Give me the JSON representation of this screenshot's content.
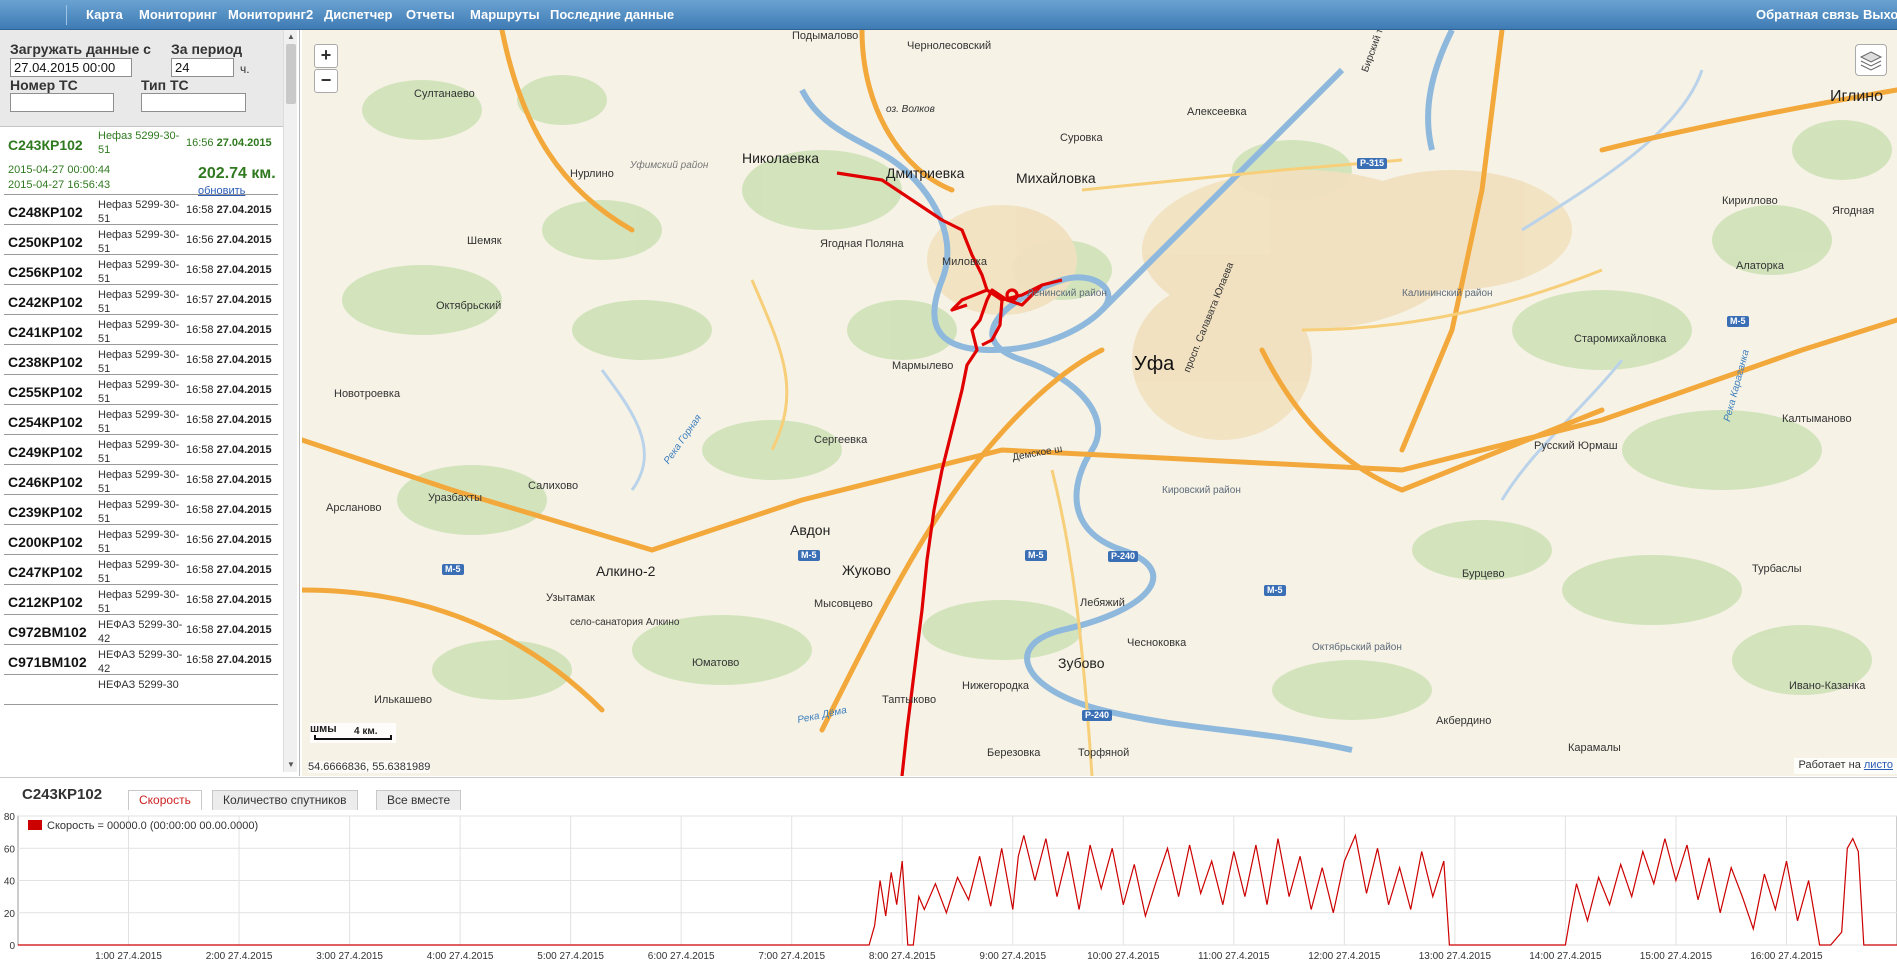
{
  "nav": {
    "left_items": [
      "Карта",
      "Мониторинг",
      "Мониторинг2",
      "Диспетчер",
      "Отчеты",
      "Маршруты",
      "Последние данные"
    ],
    "right_items": [
      "Обратная связь",
      "Выхо"
    ]
  },
  "filters": {
    "load_from_label": "Загружать данные с",
    "load_from_value": "27.04.2015 00:00",
    "period_label": "За период",
    "period_value": "24",
    "period_unit": "ч.",
    "plate_label": "Номер ТС",
    "plate_value": "",
    "type_label": "Тип ТС",
    "type_value": ""
  },
  "vehicles": [
    {
      "plate": "С243КР102",
      "model": "Нефаз 5299-30-51",
      "time": "16:56",
      "date": "27.04.2015",
      "selected": true,
      "range_from": "2015-04-27 00:00:44",
      "range_to": "2015-04-27 16:56:43",
      "distance": "202.74 км.",
      "update_label": "обновить"
    },
    {
      "plate": "С248КР102",
      "model": "Нефаз 5299-30-51",
      "time": "16:58",
      "date": "27.04.2015"
    },
    {
      "plate": "С250КР102",
      "model": "Нефаз 5299-30-51",
      "time": "16:56",
      "date": "27.04.2015"
    },
    {
      "plate": "С256КР102",
      "model": "Нефаз 5299-30-51",
      "time": "16:58",
      "date": "27.04.2015"
    },
    {
      "plate": "С242КР102",
      "model": "Нефаз 5299-30-51",
      "time": "16:57",
      "date": "27.04.2015"
    },
    {
      "plate": "С241КР102",
      "model": "Нефаз 5299-30-51",
      "time": "16:58",
      "date": "27.04.2015"
    },
    {
      "plate": "С238КР102",
      "model": "Нефаз 5299-30-51",
      "time": "16:58",
      "date": "27.04.2015"
    },
    {
      "plate": "С255КР102",
      "model": "Нефаз 5299-30-51",
      "time": "16:58",
      "date": "27.04.2015"
    },
    {
      "plate": "С254КР102",
      "model": "Нефаз 5299-30-51",
      "time": "16:58",
      "date": "27.04.2015"
    },
    {
      "plate": "С249КР102",
      "model": "Нефаз 5299-30-51",
      "time": "16:58",
      "date": "27.04.2015"
    },
    {
      "plate": "С246КР102",
      "model": "Нефаз 5299-30-51",
      "time": "16:58",
      "date": "27.04.2015"
    },
    {
      "plate": "С239КР102",
      "model": "Нефаз 5299-30-51",
      "time": "16:58",
      "date": "27.04.2015"
    },
    {
      "plate": "С200КР102",
      "model": "Нефаз 5299-30-51",
      "time": "16:56",
      "date": "27.04.2015"
    },
    {
      "plate": "С247КР102",
      "model": "Нефаз 5299-30-51",
      "time": "16:58",
      "date": "27.04.2015"
    },
    {
      "plate": "С212КР102",
      "model": "Нефаз 5299-30-51",
      "time": "16:58",
      "date": "27.04.2015"
    },
    {
      "plate": "С972ВМ102",
      "model": "НЕФАЗ 5299-30-42",
      "time": "16:58",
      "date": "27.04.2015"
    },
    {
      "plate": "С971ВМ102",
      "model": "НЕФАЗ 5299-30-42",
      "time": "16:58",
      "date": "27.04.2015"
    },
    {
      "plate": "",
      "model": "НЕФАЗ 5299-30",
      "time": "",
      "date": ""
    }
  ],
  "map": {
    "zoom_in": "+",
    "zoom_out": "−",
    "scale_label": "4 км.",
    "scale_prefix": "шмы",
    "coords": "54.6666836, 55.6381989",
    "attribution": "Работает на",
    "attribution_link": "листо",
    "labels": {
      "podymalovo": "Подымалово",
      "chernolesovsky": "Чернолесовский",
      "sultanaevo": "Султанаево",
      "ozvolkov": "оз. Волков",
      "alekseevka": "Алексеевка",
      "iglino": "Иглино",
      "surovka": "Суровка",
      "nikolaevka": "Николаевка",
      "dmitrievka": "Дмитриевка",
      "mikhailovka": "Михайловка",
      "nurlino": "Нурлино",
      "ufimsky": "Уфимский район",
      "kirillovo": "Кириллово",
      "yagodnaya": "Ягодная",
      "shemyak": "Шемяк",
      "yagodnaya_polyana": "Ягодная Поляна",
      "milovka": "Миловка",
      "alatorka": "Алаторка",
      "leninsky": "Ленинский район",
      "kalininsky": "Калининский район",
      "oktyabrsky": "Октябрьский",
      "staromikhailovka": "Старомихайловка",
      "ufa": "Уфа",
      "salavat": "просп. Салавата Юлаева",
      "marmylevo": "Мармылево",
      "novotroevka": "Новотроевка",
      "reka_gornaya": "Река Горная",
      "reka_karagankra": "Река Караганка",
      "sergeevka": "Сергеевка",
      "kaltymanovo": "Калтыманово",
      "russky_yurmash": "Русский Юрмаш",
      "demskoe": "Демское ш",
      "urazbakhty": "Уразбахты",
      "salikhovo": "Салихово",
      "kirovsky": "Кировский район",
      "arslanovo": "Арсланово",
      "avdon": "Авдон",
      "zhukovo": "Жуково",
      "lebyazhy": "Лебяжий",
      "alkino2": "Алкино-2",
      "burtsevo": "Бурцево",
      "turbasly": "Турбаслы",
      "uzytamak": "Узытамак",
      "mysovtsevo": "Мысовцево",
      "selo_sanatoriya": "село-санатория Алкино",
      "oktyabrsky_rayon": "Октябрьский район",
      "yumatovo": "Юматово",
      "zubovo": "Зубово",
      "chesnokovka": "Чесноковка",
      "ilkashevo": "Илькашево",
      "taptykovo": "Таптыково",
      "nizhegorodka": "Нижегородка",
      "ivano_kazanka": "Ивано-Казанка",
      "akberdino": "Акбердино",
      "reka_dema": "Река Дёма",
      "berezovka": "Березовка",
      "torfyanoy": "Торфяной",
      "karamaly": "Карамалы",
      "birsky": "Бирский тракт"
    },
    "road_signs": {
      "m5_a": "М-5",
      "m5_b": "М-5",
      "m5_c": "М-5",
      "m5_d": "М-5",
      "m5_e": "М-5",
      "p240_a": "Р-240",
      "p240_b": "Р-240",
      "p315": "Р-315"
    }
  },
  "bottom": {
    "vehicle_title": "С243КР102",
    "tabs": [
      "Скорость",
      "Количество спутников",
      "Все вместе"
    ],
    "active_tab": 0
  },
  "chart_data": {
    "type": "line",
    "title": "",
    "xlabel": "",
    "ylabel": "",
    "legend_label": "Скорость = 00000.0 (00:00:00 00.00.0000)",
    "series": [
      {
        "name": "Скорость",
        "color": "#cc0000",
        "points": [
          [
            0,
            0
          ],
          [
            7.7,
            0
          ],
          [
            7.75,
            12
          ],
          [
            7.8,
            40
          ],
          [
            7.85,
            18
          ],
          [
            7.9,
            45
          ],
          [
            7.95,
            25
          ],
          [
            8.0,
            52
          ],
          [
            8.05,
            0
          ],
          [
            8.1,
            0
          ],
          [
            8.15,
            30
          ],
          [
            8.2,
            22
          ],
          [
            8.3,
            38
          ],
          [
            8.4,
            20
          ],
          [
            8.5,
            42
          ],
          [
            8.6,
            28
          ],
          [
            8.7,
            55
          ],
          [
            8.8,
            24
          ],
          [
            8.9,
            60
          ],
          [
            9.0,
            22
          ],
          [
            9.05,
            55
          ],
          [
            9.1,
            68
          ],
          [
            9.2,
            40
          ],
          [
            9.3,
            66
          ],
          [
            9.4,
            30
          ],
          [
            9.5,
            58
          ],
          [
            9.6,
            22
          ],
          [
            9.7,
            62
          ],
          [
            9.8,
            35
          ],
          [
            9.9,
            60
          ],
          [
            10.0,
            25
          ],
          [
            10.1,
            50
          ],
          [
            10.2,
            18
          ],
          [
            10.3,
            40
          ],
          [
            10.4,
            60
          ],
          [
            10.5,
            30
          ],
          [
            10.6,
            62
          ],
          [
            10.7,
            32
          ],
          [
            10.8,
            52
          ],
          [
            10.9,
            25
          ],
          [
            11.0,
            58
          ],
          [
            11.1,
            30
          ],
          [
            11.2,
            62
          ],
          [
            11.3,
            25
          ],
          [
            11.4,
            66
          ],
          [
            11.5,
            30
          ],
          [
            11.6,
            55
          ],
          [
            11.7,
            22
          ],
          [
            11.8,
            48
          ],
          [
            11.9,
            20
          ],
          [
            12.0,
            52
          ],
          [
            12.1,
            68
          ],
          [
            12.2,
            32
          ],
          [
            12.3,
            60
          ],
          [
            12.4,
            25
          ],
          [
            12.5,
            48
          ],
          [
            12.6,
            22
          ],
          [
            12.7,
            58
          ],
          [
            12.8,
            30
          ],
          [
            12.9,
            52
          ],
          [
            12.95,
            0
          ],
          [
            13.0,
            0
          ],
          [
            14.0,
            0
          ],
          [
            14.05,
            20
          ],
          [
            14.1,
            38
          ],
          [
            14.2,
            15
          ],
          [
            14.3,
            42
          ],
          [
            14.4,
            25
          ],
          [
            14.5,
            50
          ],
          [
            14.6,
            30
          ],
          [
            14.7,
            58
          ],
          [
            14.8,
            38
          ],
          [
            14.9,
            66
          ],
          [
            15.0,
            40
          ],
          [
            15.1,
            62
          ],
          [
            15.2,
            28
          ],
          [
            15.3,
            54
          ],
          [
            15.4,
            20
          ],
          [
            15.5,
            48
          ],
          [
            15.6,
            30
          ],
          [
            15.7,
            10
          ],
          [
            15.8,
            44
          ],
          [
            15.9,
            22
          ],
          [
            16.0,
            52
          ],
          [
            16.1,
            15
          ],
          [
            16.2,
            40
          ],
          [
            16.3,
            0
          ],
          [
            16.4,
            0
          ],
          [
            16.5,
            8
          ],
          [
            16.55,
            60
          ],
          [
            16.6,
            66
          ],
          [
            16.65,
            58
          ],
          [
            16.7,
            0
          ],
          [
            17.0,
            0
          ]
        ]
      }
    ],
    "xlim": [
      0,
      17
    ],
    "ylim": [
      0,
      80
    ],
    "x_ticks": [
      "1:00 27.4.2015",
      "2:00 27.4.2015",
      "3:00 27.4.2015",
      "4:00 27.4.2015",
      "5:00 27.4.2015",
      "6:00 27.4.2015",
      "7:00 27.4.2015",
      "8:00 27.4.2015",
      "9:00 27.4.2015",
      "10:00 27.4.2015",
      "11:00 27.4.2015",
      "12:00 27.4.2015",
      "13:00 27.4.2015",
      "14:00 27.4.2015",
      "15:00 27.4.2015",
      "16:00 27.4.2015"
    ],
    "y_ticks": [
      "0",
      "20",
      "40",
      "60",
      "80"
    ],
    "grid": true,
    "legend_position": "top-left"
  },
  "colors": {
    "accent": "#3f7bb4",
    "route": "#e00000",
    "selected_text": "#2f7a1f"
  }
}
